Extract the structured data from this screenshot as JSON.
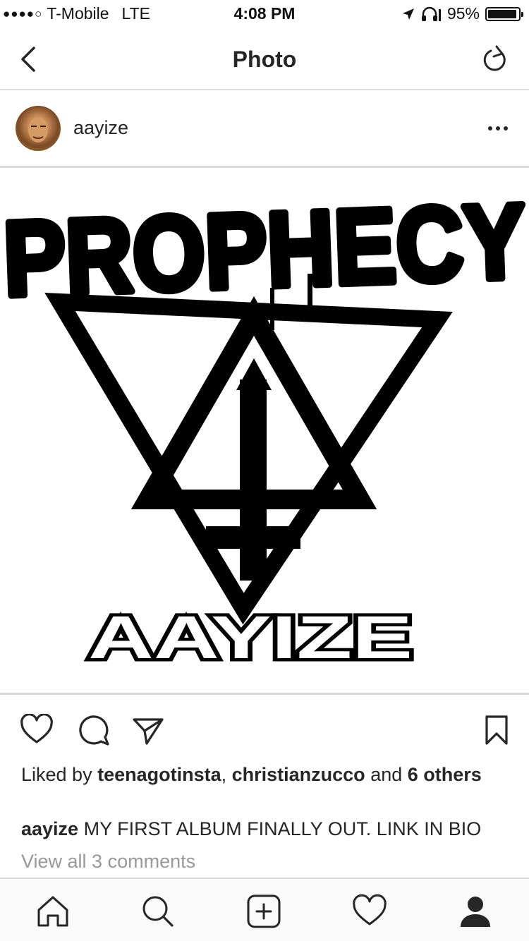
{
  "status_bar": {
    "signal_dots": "●●●●○",
    "carrier": "T-Mobile",
    "network": "LTE",
    "time": "4:08 PM",
    "battery_percent": "95%",
    "battery_level": 0.95,
    "icons": [
      "location-arrow-icon",
      "headphones-icon",
      "battery-icon"
    ]
  },
  "navbar": {
    "title": "Photo",
    "left_icon": "back-chevron-icon",
    "right_icon": "refresh-icon"
  },
  "post": {
    "username": "aayize",
    "more_icon": "more-options-icon",
    "image": {
      "top_text": "PROPHECY",
      "bottom_text": "AAYIZE"
    },
    "actions": [
      "heart-icon",
      "comment-icon",
      "share-icon",
      "bookmark-icon"
    ],
    "likes": {
      "prefix": "Liked by ",
      "user1": "teenagotinsta",
      "separator": ", ",
      "user2": "christianzucco",
      "and": " and ",
      "others": "6 others"
    },
    "caption": {
      "user": "aayize",
      "text": "MY FIRST ALBUM FINALLY OUT. LINK IN BIO"
    },
    "view_comments": "View all 3 comments"
  },
  "tabbar": {
    "tabs": [
      "home-icon",
      "search-icon",
      "add-post-icon",
      "activity-heart-icon",
      "profile-icon"
    ],
    "active": "profile-icon"
  },
  "colors": {
    "text": "#262626",
    "muted": "#999999",
    "divider": "#dbdbdb"
  }
}
